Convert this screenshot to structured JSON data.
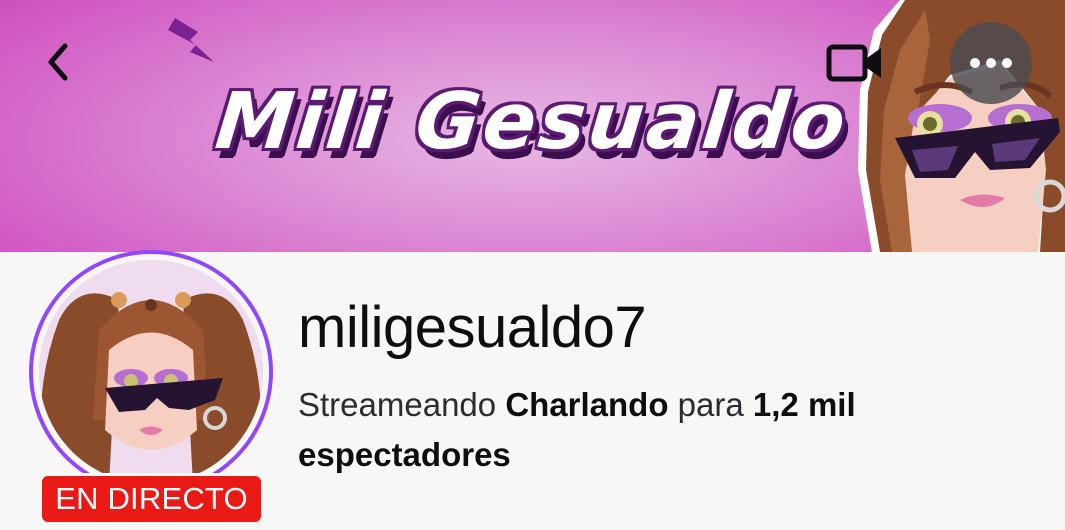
{
  "banner": {
    "title": "Mili Gesualdo"
  },
  "header": {
    "back_icon": "chevron-left-icon",
    "camera_icon": "video-camera-icon",
    "more_icon": "more-horizontal-icon"
  },
  "channel": {
    "name": "miligesualdo7",
    "live_badge": "EN DIRECTO",
    "status_prefix": "Streameando",
    "category": "Charlando",
    "status_middle": "para",
    "viewer_count": "1,2 mil",
    "viewer_suffix": "espectadores"
  },
  "colors": {
    "accent": "#9147ff",
    "live_red": "#e91916",
    "banner_pink": "#d462c7"
  }
}
